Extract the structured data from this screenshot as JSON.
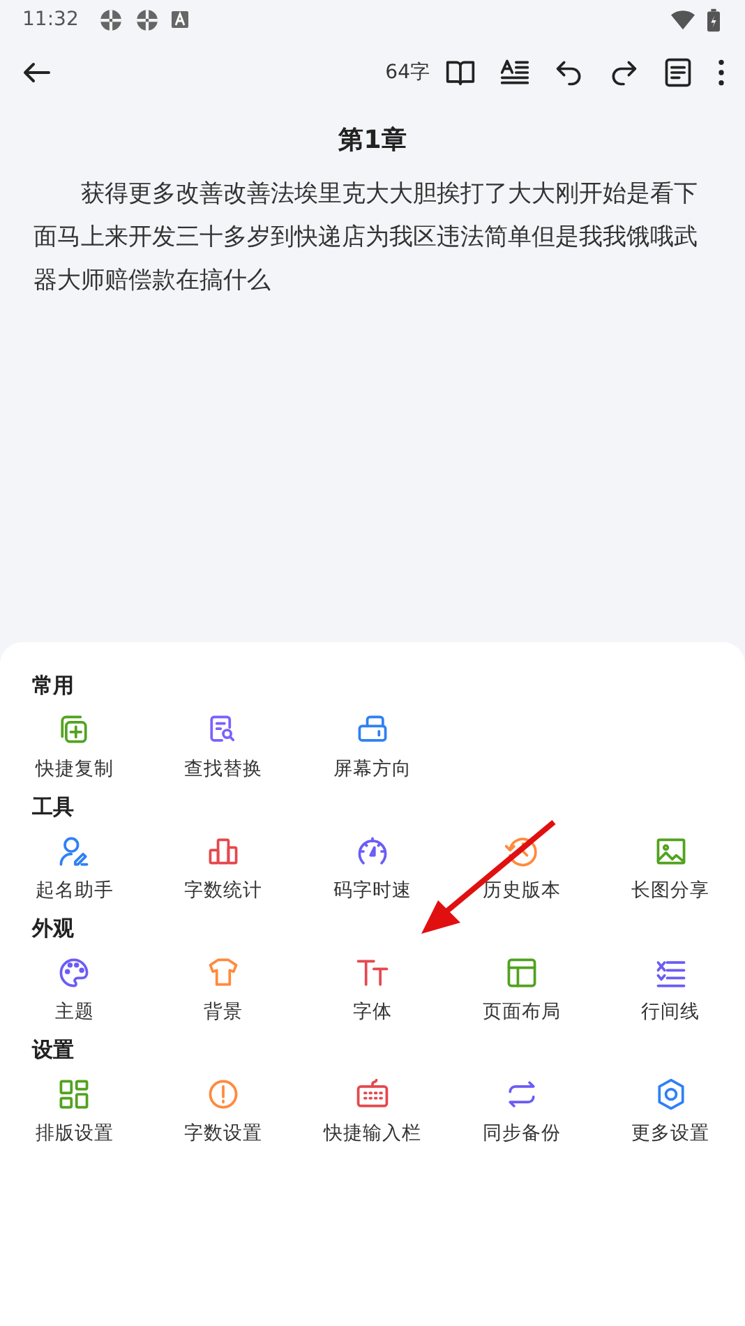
{
  "status_bar": {
    "time": "11:32"
  },
  "toolbar": {
    "word_count": "64字"
  },
  "document": {
    "title": "第1章",
    "body": "获得更多改善改善法埃里克大大胆挨打了大大刚开始是看下面马上来开发三十多岁到快递店为我区违法简单但是我我饿哦武器大师赔偿款在搞什么"
  },
  "sections": [
    {
      "title": "常用",
      "items": [
        {
          "label": "快捷复制",
          "color": "#52a21f"
        },
        {
          "label": "查找替换",
          "color": "#7b61ff"
        },
        {
          "label": "屏幕方向",
          "color": "#2f80f5"
        }
      ]
    },
    {
      "title": "工具",
      "items": [
        {
          "label": "起名助手",
          "color": "#2f80f5"
        },
        {
          "label": "字数统计",
          "color": "#e5484d"
        },
        {
          "label": "码字时速",
          "color": "#6b5cf6"
        },
        {
          "label": "历史版本",
          "color": "#ff8a3d"
        },
        {
          "label": "长图分享",
          "color": "#52a21f"
        }
      ]
    },
    {
      "title": "外观",
      "items": [
        {
          "label": "主题",
          "color": "#6b5cf6"
        },
        {
          "label": "背景",
          "color": "#ff8a3d"
        },
        {
          "label": "字体",
          "color": "#e5484d"
        },
        {
          "label": "页面布局",
          "color": "#52a21f"
        },
        {
          "label": "行间线",
          "color": "#6b5cf6"
        }
      ]
    },
    {
      "title": "设置",
      "items": [
        {
          "label": "排版设置",
          "color": "#52a21f"
        },
        {
          "label": "字数设置",
          "color": "#ff8a3d"
        },
        {
          "label": "快捷输入栏",
          "color": "#e5484d"
        },
        {
          "label": "同步备份",
          "color": "#6b5cf6"
        },
        {
          "label": "更多设置",
          "color": "#2f80f5"
        }
      ]
    }
  ]
}
